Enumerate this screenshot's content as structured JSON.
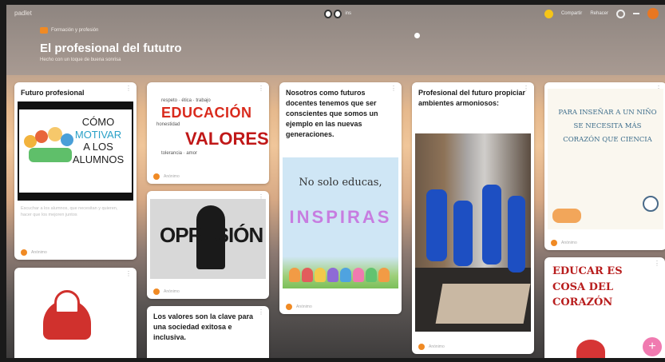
{
  "app": {
    "label": "padlet",
    "logo_text": "ins"
  },
  "toolbar": {
    "share_label": "Compartir",
    "remake_label": "Rehacer"
  },
  "breadcrumb": {
    "text": "Formación y profesión"
  },
  "board": {
    "title": "El profesional del fututro",
    "subtitle": "Hecho con un toque de buena sonrisa"
  },
  "posts": {
    "futuro": {
      "title": "Futuro profesional",
      "image_text": [
        "CÓMO",
        "MOTIVAR",
        "A LOS",
        "ALUMNOS"
      ],
      "caption": "Escuchar a los alumnos, que necesitan y quieren, hacer que los mejoren juntos",
      "author": "Anónimo"
    },
    "educacion": {
      "word1": "EDUCACIÓN",
      "word2": "VALORES",
      "author": "Anónimo"
    },
    "opresion": {
      "word": "OPRESIÓN",
      "author": "Anónimo"
    },
    "valores": {
      "title": "Los valores son la clave para una sociedad exitosa e inclusiva."
    },
    "nosotros": {
      "title": "Nosotros como futuros docentes tenemos que ser conscientes que somos un ejemplo en las nuevas generaciones.",
      "line1": "No solo educas,",
      "line2": "INSPIRAS",
      "author": "Anónimo"
    },
    "ambientes": {
      "title": "Profesional del futuro propiciar ambientes armoniosos:",
      "author": "Anónimo"
    },
    "ninos": {
      "text": "PARA INSEÑAR A UN NIÑO SE NECESITA MÁS CORAZÓN QUE CIENCIA",
      "author": "Anónimo"
    },
    "corazon": {
      "text": "EDUCAR ES COSA DEL CORAZÓN"
    }
  },
  "colors": {
    "accent": "#f08a24",
    "fab": "#f07ab0"
  },
  "icons": [
    "more-icon",
    "gear-icon",
    "add-icon",
    "avatar-icon"
  ]
}
